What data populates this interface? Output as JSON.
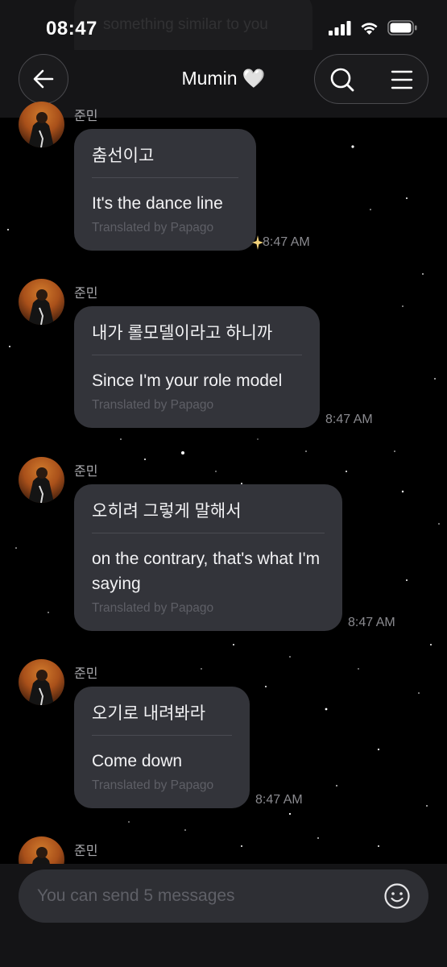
{
  "status_bar": {
    "time": "08:47",
    "ghost_text": "something similar to you"
  },
  "header": {
    "title": "Mumin 🤍"
  },
  "messages": [
    {
      "sender": "준민",
      "original": "춤선이고",
      "translation": "It's the dance line",
      "translated_by": "Translated by Papago",
      "time": "8:47 AM"
    },
    {
      "sender": "준민",
      "original": "내가 롤모델이라고 하니까",
      "translation": "Since I'm your role model",
      "translated_by": "Translated by Papago",
      "time": "8:47 AM"
    },
    {
      "sender": "준민",
      "original": "오히려 그렇게 말해서",
      "translation": "on the contrary, that's what I'm saying",
      "translated_by": "Translated by Papago",
      "time": "8:47 AM"
    },
    {
      "sender": "준민",
      "original": "오기로 내려봐라",
      "translation": "Come down",
      "translated_by": "Translated by Papago",
      "time": "8:47 AM"
    },
    {
      "sender": "준민"
    }
  ],
  "input": {
    "placeholder": "You can send 5 messages"
  },
  "icons": [
    "back-arrow-icon",
    "search-icon",
    "menu-icon",
    "emoji-icon",
    "signal-icon",
    "wifi-icon",
    "battery-icon",
    "sparkle-icon"
  ]
}
